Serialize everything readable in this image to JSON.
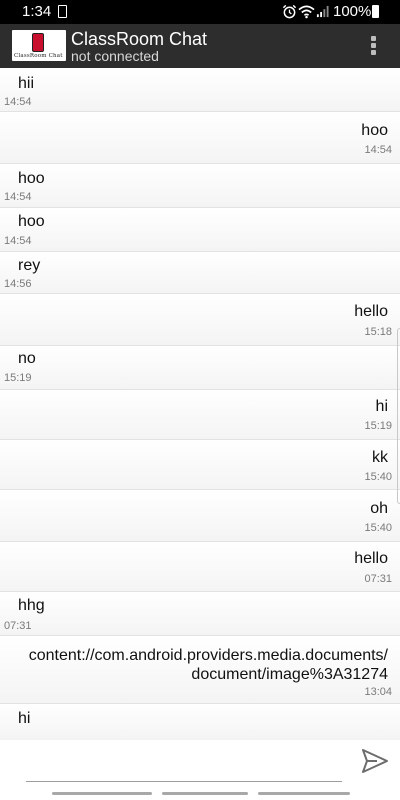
{
  "status_bar": {
    "time": "1:34",
    "battery_text": "100%",
    "icons": [
      "sim-icon",
      "alarm-icon",
      "wifi-icon",
      "signal-icon",
      "battery-icon"
    ]
  },
  "app_bar": {
    "title": "ClassRoom Chat",
    "subtitle": "not connected",
    "logo_text": "ClassRoom Chat",
    "menu_icon": "overflow-menu-icon"
  },
  "messages": [
    {
      "text": "hii",
      "time": "14:54",
      "side": "left"
    },
    {
      "text": "hoo",
      "time": "14:54",
      "side": "right"
    },
    {
      "text": "hoo",
      "time": "14:54",
      "side": "left"
    },
    {
      "text": "hoo",
      "time": "14:54",
      "side": "left"
    },
    {
      "text": "rey",
      "time": "14:56",
      "side": "left"
    },
    {
      "text": "hello",
      "time": "15:18",
      "side": "right"
    },
    {
      "text": "no",
      "time": "15:19",
      "side": "left"
    },
    {
      "text": "hi",
      "time": "15:19",
      "side": "right"
    },
    {
      "text": "kk",
      "time": "15:40",
      "side": "right"
    },
    {
      "text": "oh",
      "time": "15:40",
      "side": "right"
    },
    {
      "text": "hello",
      "time": "07:31",
      "side": "right"
    },
    {
      "text": "hhg",
      "time": "07:31",
      "side": "left"
    },
    {
      "text": "content://com.android.providers.media.documents/document/image%3A31274",
      "time": "13:04",
      "side": "right"
    },
    {
      "text": "hi",
      "time": "",
      "side": "left"
    }
  ],
  "composer": {
    "input_value": "",
    "send_icon": "send-icon"
  }
}
